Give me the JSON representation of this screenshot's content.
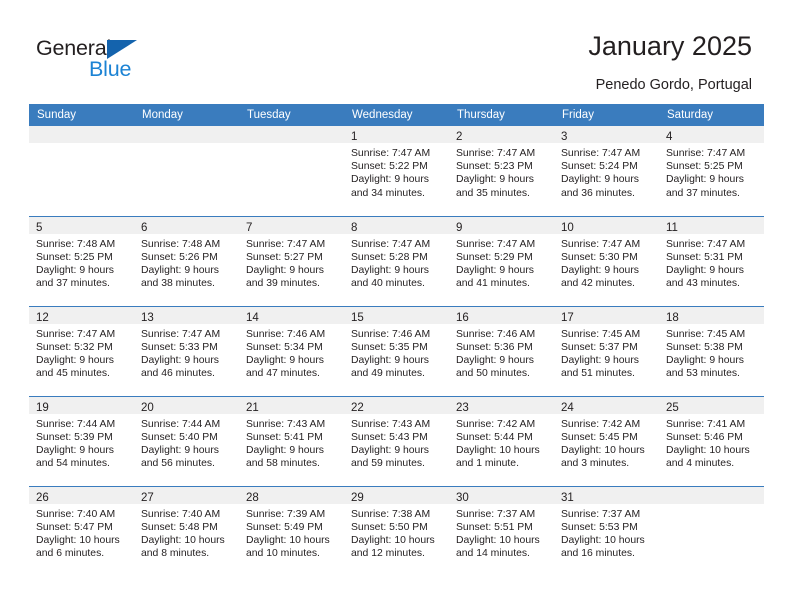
{
  "brand": {
    "name_part1": "General",
    "name_part2": "Blue",
    "triangle_color": "#1463ad",
    "blue_color": "#1c83d4"
  },
  "header": {
    "title": "January 2025",
    "subtitle": "Penedo Gordo, Portugal"
  },
  "theme": {
    "header_bg": "#3a7cbe",
    "header_text": "#ffffff",
    "daynum_band_bg": "#f0f0f0",
    "text_color": "#231f20"
  },
  "weekday_headers": [
    "Sunday",
    "Monday",
    "Tuesday",
    "Wednesday",
    "Thursday",
    "Friday",
    "Saturday"
  ],
  "weeks": [
    [
      {
        "day": "",
        "empty": true,
        "sunrise": "",
        "sunset": "",
        "daylight_line1": "",
        "daylight_line2": ""
      },
      {
        "day": "",
        "empty": true,
        "sunrise": "",
        "sunset": "",
        "daylight_line1": "",
        "daylight_line2": ""
      },
      {
        "day": "",
        "empty": true,
        "sunrise": "",
        "sunset": "",
        "daylight_line1": "",
        "daylight_line2": ""
      },
      {
        "day": "1",
        "empty": false,
        "sunrise": "Sunrise: 7:47 AM",
        "sunset": "Sunset: 5:22 PM",
        "daylight_line1": "Daylight: 9 hours",
        "daylight_line2": "and 34 minutes."
      },
      {
        "day": "2",
        "empty": false,
        "sunrise": "Sunrise: 7:47 AM",
        "sunset": "Sunset: 5:23 PM",
        "daylight_line1": "Daylight: 9 hours",
        "daylight_line2": "and 35 minutes."
      },
      {
        "day": "3",
        "empty": false,
        "sunrise": "Sunrise: 7:47 AM",
        "sunset": "Sunset: 5:24 PM",
        "daylight_line1": "Daylight: 9 hours",
        "daylight_line2": "and 36 minutes."
      },
      {
        "day": "4",
        "empty": false,
        "sunrise": "Sunrise: 7:47 AM",
        "sunset": "Sunset: 5:25 PM",
        "daylight_line1": "Daylight: 9 hours",
        "daylight_line2": "and 37 minutes."
      }
    ],
    [
      {
        "day": "5",
        "empty": false,
        "sunrise": "Sunrise: 7:48 AM",
        "sunset": "Sunset: 5:25 PM",
        "daylight_line1": "Daylight: 9 hours",
        "daylight_line2": "and 37 minutes."
      },
      {
        "day": "6",
        "empty": false,
        "sunrise": "Sunrise: 7:48 AM",
        "sunset": "Sunset: 5:26 PM",
        "daylight_line1": "Daylight: 9 hours",
        "daylight_line2": "and 38 minutes."
      },
      {
        "day": "7",
        "empty": false,
        "sunrise": "Sunrise: 7:47 AM",
        "sunset": "Sunset: 5:27 PM",
        "daylight_line1": "Daylight: 9 hours",
        "daylight_line2": "and 39 minutes."
      },
      {
        "day": "8",
        "empty": false,
        "sunrise": "Sunrise: 7:47 AM",
        "sunset": "Sunset: 5:28 PM",
        "daylight_line1": "Daylight: 9 hours",
        "daylight_line2": "and 40 minutes."
      },
      {
        "day": "9",
        "empty": false,
        "sunrise": "Sunrise: 7:47 AM",
        "sunset": "Sunset: 5:29 PM",
        "daylight_line1": "Daylight: 9 hours",
        "daylight_line2": "and 41 minutes."
      },
      {
        "day": "10",
        "empty": false,
        "sunrise": "Sunrise: 7:47 AM",
        "sunset": "Sunset: 5:30 PM",
        "daylight_line1": "Daylight: 9 hours",
        "daylight_line2": "and 42 minutes."
      },
      {
        "day": "11",
        "empty": false,
        "sunrise": "Sunrise: 7:47 AM",
        "sunset": "Sunset: 5:31 PM",
        "daylight_line1": "Daylight: 9 hours",
        "daylight_line2": "and 43 minutes."
      }
    ],
    [
      {
        "day": "12",
        "empty": false,
        "sunrise": "Sunrise: 7:47 AM",
        "sunset": "Sunset: 5:32 PM",
        "daylight_line1": "Daylight: 9 hours",
        "daylight_line2": "and 45 minutes."
      },
      {
        "day": "13",
        "empty": false,
        "sunrise": "Sunrise: 7:47 AM",
        "sunset": "Sunset: 5:33 PM",
        "daylight_line1": "Daylight: 9 hours",
        "daylight_line2": "and 46 minutes."
      },
      {
        "day": "14",
        "empty": false,
        "sunrise": "Sunrise: 7:46 AM",
        "sunset": "Sunset: 5:34 PM",
        "daylight_line1": "Daylight: 9 hours",
        "daylight_line2": "and 47 minutes."
      },
      {
        "day": "15",
        "empty": false,
        "sunrise": "Sunrise: 7:46 AM",
        "sunset": "Sunset: 5:35 PM",
        "daylight_line1": "Daylight: 9 hours",
        "daylight_line2": "and 49 minutes."
      },
      {
        "day": "16",
        "empty": false,
        "sunrise": "Sunrise: 7:46 AM",
        "sunset": "Sunset: 5:36 PM",
        "daylight_line1": "Daylight: 9 hours",
        "daylight_line2": "and 50 minutes."
      },
      {
        "day": "17",
        "empty": false,
        "sunrise": "Sunrise: 7:45 AM",
        "sunset": "Sunset: 5:37 PM",
        "daylight_line1": "Daylight: 9 hours",
        "daylight_line2": "and 51 minutes."
      },
      {
        "day": "18",
        "empty": false,
        "sunrise": "Sunrise: 7:45 AM",
        "sunset": "Sunset: 5:38 PM",
        "daylight_line1": "Daylight: 9 hours",
        "daylight_line2": "and 53 minutes."
      }
    ],
    [
      {
        "day": "19",
        "empty": false,
        "sunrise": "Sunrise: 7:44 AM",
        "sunset": "Sunset: 5:39 PM",
        "daylight_line1": "Daylight: 9 hours",
        "daylight_line2": "and 54 minutes."
      },
      {
        "day": "20",
        "empty": false,
        "sunrise": "Sunrise: 7:44 AM",
        "sunset": "Sunset: 5:40 PM",
        "daylight_line1": "Daylight: 9 hours",
        "daylight_line2": "and 56 minutes."
      },
      {
        "day": "21",
        "empty": false,
        "sunrise": "Sunrise: 7:43 AM",
        "sunset": "Sunset: 5:41 PM",
        "daylight_line1": "Daylight: 9 hours",
        "daylight_line2": "and 58 minutes."
      },
      {
        "day": "22",
        "empty": false,
        "sunrise": "Sunrise: 7:43 AM",
        "sunset": "Sunset: 5:43 PM",
        "daylight_line1": "Daylight: 9 hours",
        "daylight_line2": "and 59 minutes."
      },
      {
        "day": "23",
        "empty": false,
        "sunrise": "Sunrise: 7:42 AM",
        "sunset": "Sunset: 5:44 PM",
        "daylight_line1": "Daylight: 10 hours",
        "daylight_line2": "and 1 minute."
      },
      {
        "day": "24",
        "empty": false,
        "sunrise": "Sunrise: 7:42 AM",
        "sunset": "Sunset: 5:45 PM",
        "daylight_line1": "Daylight: 10 hours",
        "daylight_line2": "and 3 minutes."
      },
      {
        "day": "25",
        "empty": false,
        "sunrise": "Sunrise: 7:41 AM",
        "sunset": "Sunset: 5:46 PM",
        "daylight_line1": "Daylight: 10 hours",
        "daylight_line2": "and 4 minutes."
      }
    ],
    [
      {
        "day": "26",
        "empty": false,
        "sunrise": "Sunrise: 7:40 AM",
        "sunset": "Sunset: 5:47 PM",
        "daylight_line1": "Daylight: 10 hours",
        "daylight_line2": "and 6 minutes."
      },
      {
        "day": "27",
        "empty": false,
        "sunrise": "Sunrise: 7:40 AM",
        "sunset": "Sunset: 5:48 PM",
        "daylight_line1": "Daylight: 10 hours",
        "daylight_line2": "and 8 minutes."
      },
      {
        "day": "28",
        "empty": false,
        "sunrise": "Sunrise: 7:39 AM",
        "sunset": "Sunset: 5:49 PM",
        "daylight_line1": "Daylight: 10 hours",
        "daylight_line2": "and 10 minutes."
      },
      {
        "day": "29",
        "empty": false,
        "sunrise": "Sunrise: 7:38 AM",
        "sunset": "Sunset: 5:50 PM",
        "daylight_line1": "Daylight: 10 hours",
        "daylight_line2": "and 12 minutes."
      },
      {
        "day": "30",
        "empty": false,
        "sunrise": "Sunrise: 7:37 AM",
        "sunset": "Sunset: 5:51 PM",
        "daylight_line1": "Daylight: 10 hours",
        "daylight_line2": "and 14 minutes."
      },
      {
        "day": "31",
        "empty": false,
        "sunrise": "Sunrise: 7:37 AM",
        "sunset": "Sunset: 5:53 PM",
        "daylight_line1": "Daylight: 10 hours",
        "daylight_line2": "and 16 minutes."
      },
      {
        "day": "",
        "empty": true,
        "sunrise": "",
        "sunset": "",
        "daylight_line1": "",
        "daylight_line2": ""
      }
    ]
  ]
}
